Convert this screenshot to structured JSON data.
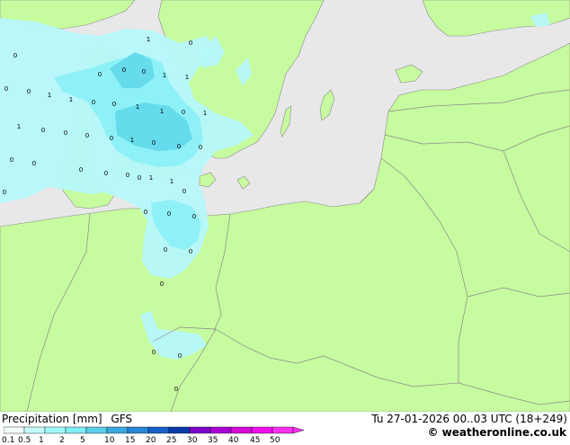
{
  "legend": {
    "title": "Precipitation [mm]",
    "model": "GFS",
    "ticks": [
      "0.1",
      "0.5",
      "1",
      "2",
      "5",
      "10",
      "15",
      "20",
      "25",
      "30",
      "35",
      "40",
      "45",
      "50"
    ],
    "colors": [
      "#f5fefe",
      "#c5fcfc",
      "#a1fafa",
      "#7eeef4",
      "#5acfe8",
      "#3aa9e0",
      "#2886d8",
      "#1661c8",
      "#0a3aa8",
      "#7a06c8",
      "#a806d4",
      "#d40ad8",
      "#ee10ea",
      "#f830f0"
    ]
  },
  "valid_time": "Tu 27-01-2026 00..03 UTC (18+249)",
  "credit": "© weatheronline.co.uk",
  "map": {
    "land_color": "#c7fb9f",
    "sea_color": "#e8e8e8",
    "precip_light": "#b6f8fb",
    "precip_medium": "#8bf0f7",
    "precip_heavy": "#5ed7ea",
    "station_values": [
      "0",
      "1",
      "0",
      "0",
      "0",
      "1",
      "1",
      "0",
      "0",
      "0",
      "0",
      "1",
      "1",
      "1",
      "1",
      "0",
      "0",
      "0",
      "0",
      "1",
      "1",
      "0",
      "0",
      "1",
      "0",
      "0",
      "0",
      "0",
      "0",
      "0",
      "0",
      "0",
      "1",
      "1",
      "0",
      "0",
      "0",
      "0",
      "0"
    ]
  }
}
